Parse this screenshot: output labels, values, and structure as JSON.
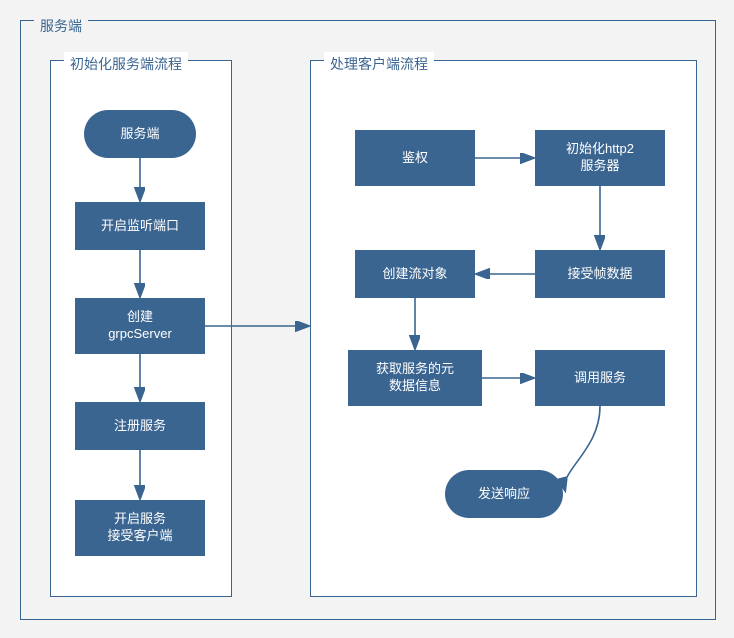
{
  "chart_data": {
    "type": "diagram",
    "title": "服务端",
    "groups": [
      {
        "id": "init",
        "title": "初始化服务端流程",
        "nodes": [
          {
            "id": "start",
            "label": "服务端",
            "shape": "rounded"
          },
          {
            "id": "listen",
            "label": "开启监听端口",
            "shape": "rect"
          },
          {
            "id": "create",
            "label": "创建\ngrpcServer",
            "shape": "rect"
          },
          {
            "id": "register",
            "label": "注册服务",
            "shape": "rect"
          },
          {
            "id": "serve",
            "label": "开启服务\n接受客户端",
            "shape": "rect"
          }
        ],
        "edges": [
          [
            "start",
            "listen"
          ],
          [
            "listen",
            "create"
          ],
          [
            "create",
            "register"
          ],
          [
            "register",
            "serve"
          ]
        ]
      },
      {
        "id": "handle",
        "title": "处理客户端流程",
        "nodes": [
          {
            "id": "auth",
            "label": "鉴权",
            "shape": "rect"
          },
          {
            "id": "http2",
            "label": "初始化http2\n服务器",
            "shape": "rect"
          },
          {
            "id": "frame",
            "label": "接受帧数据",
            "shape": "rect"
          },
          {
            "id": "stream",
            "label": "创建流对象",
            "shape": "rect"
          },
          {
            "id": "meta",
            "label": "获取服务的元\n数据信息",
            "shape": "rect"
          },
          {
            "id": "invoke",
            "label": "调用服务",
            "shape": "rect"
          },
          {
            "id": "respond",
            "label": "发送响应",
            "shape": "rounded"
          }
        ],
        "edges": [
          [
            "auth",
            "http2"
          ],
          [
            "http2",
            "frame"
          ],
          [
            "frame",
            "stream"
          ],
          [
            "stream",
            "meta"
          ],
          [
            "meta",
            "invoke"
          ],
          [
            "invoke",
            "respond"
          ]
        ]
      }
    ],
    "cross_edges": [
      [
        "init.create",
        "handle.stream"
      ]
    ]
  }
}
